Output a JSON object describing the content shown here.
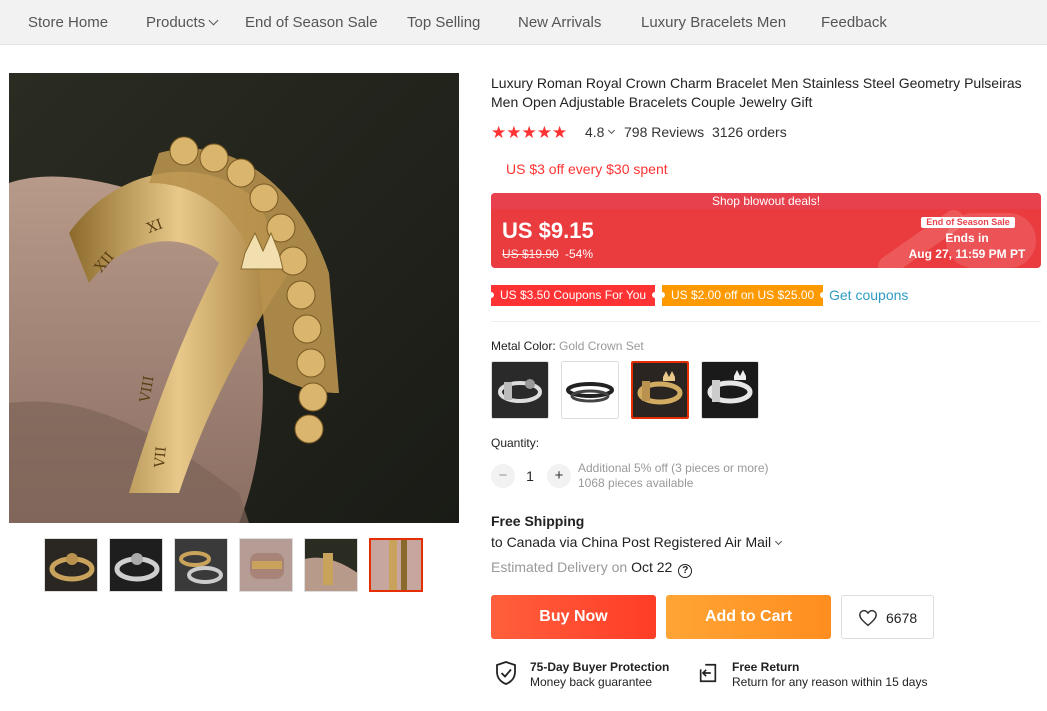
{
  "nav": {
    "items": [
      {
        "label": "Store Home"
      },
      {
        "label": "Products"
      },
      {
        "label": "End of Season Sale"
      },
      {
        "label": "Top Selling"
      },
      {
        "label": "New Arrivals"
      },
      {
        "label": "Luxury Bracelets Men"
      },
      {
        "label": "Feedback"
      }
    ]
  },
  "product": {
    "title": "Luxury Roman Royal Crown Charm Bracelet Men Stainless Steel Geometry Pulseiras Men Open Adjustable Bracelets Couple Jewelry Gift",
    "rating": "4.8",
    "stars": "★★★★★",
    "reviews": "798 Reviews",
    "orders": "3126 orders",
    "store_discount": "US $3 off every $30 spent"
  },
  "price": {
    "banner": "Shop blowout deals!",
    "current": "US $9.15",
    "original": "US $19.90",
    "discount": "-54%",
    "sale_tag": "End of Season Sale",
    "ends_in": "Ends in",
    "ends_date": "Aug 27, 11:59 PM PT"
  },
  "coupons": {
    "coupon_1": "US $3.50 Coupons For You",
    "coupon_2": "US $2.00 off on US $25.00",
    "get_coupons": "Get coupons"
  },
  "variant": {
    "label": "Metal Color:",
    "selected": "Gold Crown Set",
    "selected_index": 2
  },
  "quantity": {
    "label": "Quantity:",
    "value": "1",
    "minus": "−",
    "plus": "+",
    "note_1": "Additional 5% off (3 pieces or more)",
    "note_2": "1068 pieces available"
  },
  "shipping": {
    "title": "Free Shipping",
    "detail": "to Canada via China Post Registered Air Mail",
    "delivery_prefix": "Estimated Delivery on",
    "delivery_date": "Oct 22",
    "help": "?"
  },
  "actions": {
    "buy_now": "Buy Now",
    "add_to_cart": "Add to Cart",
    "wishlist_count": "6678"
  },
  "guarantees": {
    "protection_title": "75-Day Buyer Protection",
    "protection_sub": "Money back guarantee",
    "return_title": "Free Return",
    "return_sub": "Return for any reason within 15 days"
  },
  "colors": {
    "accent_red": "#f33",
    "coupon_orange": "#f90",
    "link_blue": "#2e9cc3",
    "selected_border": "#e62e04"
  }
}
